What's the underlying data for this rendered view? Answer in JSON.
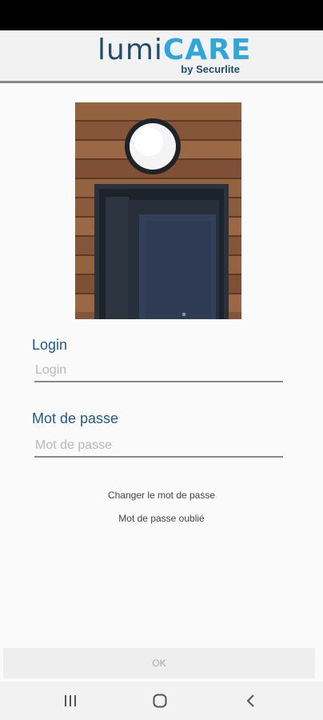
{
  "header": {
    "logo_primary": "lumi",
    "logo_accent": "CARE",
    "logo_tagline": "by Securlite"
  },
  "login": {
    "label": "Login",
    "placeholder": "Login",
    "value": ""
  },
  "password": {
    "label": "Mot de passe",
    "placeholder": "Mot de passe",
    "value": ""
  },
  "links": {
    "change_password": "Changer le mot de passe",
    "forgot_password": "Mot de passe oublié"
  },
  "actions": {
    "ok_label": "OK"
  },
  "nav": {
    "recents_icon": "recents-icon",
    "home_icon": "home-icon",
    "back_icon": "back-icon"
  },
  "colors": {
    "brand_dark": "#1f4d6e",
    "brand_accent": "#2fa7dc",
    "label_blue": "#1f5a90"
  }
}
